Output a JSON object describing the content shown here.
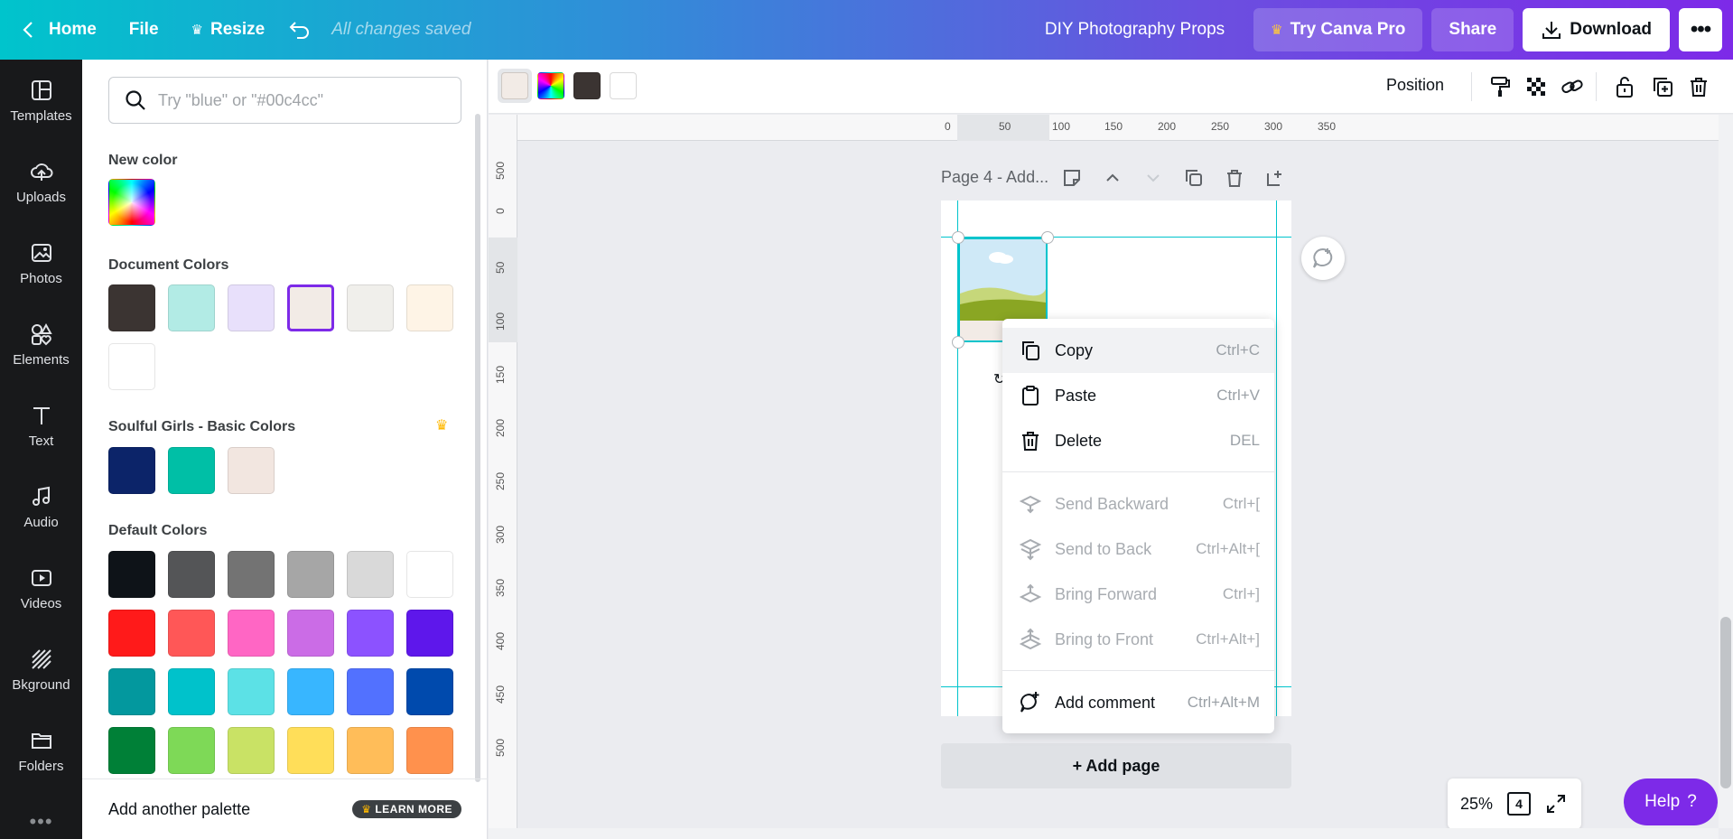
{
  "topbar": {
    "home_label": "Home",
    "file_label": "File",
    "resize_label": "Resize",
    "saved_status": "All changes saved",
    "design_title": "DIY Photography Props",
    "try_pro_label": "Try Canva Pro",
    "share_label": "Share",
    "download_label": "Download",
    "more_label": "•••"
  },
  "sidenav": {
    "items": [
      {
        "label": "Templates",
        "icon": "templates-icon"
      },
      {
        "label": "Uploads",
        "icon": "upload-cloud-icon"
      },
      {
        "label": "Photos",
        "icon": "photo-icon"
      },
      {
        "label": "Elements",
        "icon": "shapes-icon"
      },
      {
        "label": "Text",
        "icon": "text-icon"
      },
      {
        "label": "Audio",
        "icon": "music-note-icon"
      },
      {
        "label": "Videos",
        "icon": "video-icon"
      },
      {
        "label": "Bkground",
        "icon": "background-pattern-icon"
      },
      {
        "label": "Folders",
        "icon": "folder-icon"
      }
    ],
    "more": "•••"
  },
  "color_panel": {
    "search_placeholder": "Try \"blue\" or \"#00c4cc\"",
    "new_color_title": "New color",
    "document_colors_title": "Document Colors",
    "document_colors": [
      "#3b3432",
      "#b2ebe5",
      "#e8e0fb",
      "#f2ebe6",
      "#f0efeb",
      "#fef4e6",
      "#ffffff"
    ],
    "document_selected_index": 3,
    "palette_title": "Soulful Girls - Basic Colors",
    "palette_colors": [
      "#0c2469",
      "#00bfa6",
      "#f2e6e0"
    ],
    "default_colors_title": "Default Colors",
    "default_colors": [
      "#0e1318",
      "#545557",
      "#737373",
      "#a6a6a6",
      "#d9d9d9",
      "#ffffff",
      "#ff1a1a",
      "#ff5757",
      "#ff66c4",
      "#cb6ce6",
      "#8c52ff",
      "#5e17eb",
      "#03989e",
      "#00c2cb",
      "#5ce1e6",
      "#38b6ff",
      "#5271ff",
      "#004aad",
      "#008037",
      "#7ed957",
      "#c9e265",
      "#ffde59",
      "#ffbd59",
      "#ff914d"
    ],
    "add_palette_label": "Add another palette",
    "learn_more_label": "LEARN MORE"
  },
  "toolbar": {
    "swatches": [
      "#f2ebe6",
      "rainbow",
      "#3b3432",
      "#ffffff"
    ],
    "position_label": "Position"
  },
  "ruler": {
    "top_labels": [
      "0",
      "50",
      "100",
      "150",
      "200",
      "250",
      "300",
      "350"
    ],
    "left_labels": [
      "500",
      "0",
      "50",
      "100",
      "150",
      "200",
      "250",
      "300",
      "350",
      "400",
      "450",
      "500"
    ]
  },
  "canvas": {
    "page_header": "Page 4 - Add...",
    "add_page_label": "+ Add page"
  },
  "context_menu": {
    "items": [
      {
        "label": "Copy",
        "shortcut": "Ctrl+C",
        "icon": "copy-icon",
        "disabled": false
      },
      {
        "label": "Paste",
        "shortcut": "Ctrl+V",
        "icon": "paste-icon",
        "disabled": false
      },
      {
        "label": "Delete",
        "shortcut": "DEL",
        "icon": "trash-icon",
        "disabled": false
      },
      {
        "label": "Send Backward",
        "shortcut": "Ctrl+[",
        "icon": "send-backward-icon",
        "disabled": true
      },
      {
        "label": "Send to Back",
        "shortcut": "Ctrl+Alt+[",
        "icon": "send-to-back-icon",
        "disabled": true
      },
      {
        "label": "Bring Forward",
        "shortcut": "Ctrl+]",
        "icon": "bring-forward-icon",
        "disabled": true
      },
      {
        "label": "Bring to Front",
        "shortcut": "Ctrl+Alt+]",
        "icon": "bring-to-front-icon",
        "disabled": true
      },
      {
        "label": "Add comment",
        "shortcut": "Ctrl+Alt+M",
        "icon": "add-comment-icon",
        "disabled": false
      }
    ]
  },
  "bottom": {
    "zoom": "25%",
    "page_count": "4",
    "help_label": "Help",
    "help_icon": "?"
  },
  "colors": {
    "accent": "#7d2ae8",
    "guide": "#00c4cc"
  }
}
